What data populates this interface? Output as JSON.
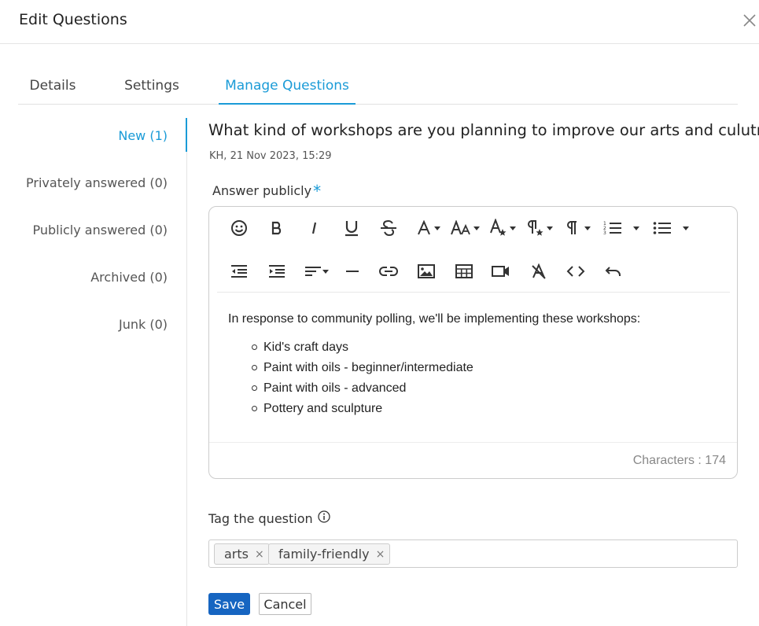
{
  "dialog": {
    "title": "Edit Questions"
  },
  "tabs": [
    {
      "label": "Details"
    },
    {
      "label": "Settings"
    },
    {
      "label": "Manage Questions"
    }
  ],
  "active_tab": "Manage Questions",
  "side_nav": [
    {
      "label": "New (1)"
    },
    {
      "label": "Privately answered (0)"
    },
    {
      "label": "Publicly answered (0)"
    },
    {
      "label": "Archived (0)"
    },
    {
      "label": "Junk (0)"
    }
  ],
  "active_side_item": "New (1)",
  "question": {
    "text": "What kind of workshops are you planning to improve our arts and culutre?",
    "meta": "KH, 21 Nov 2023, 15:29"
  },
  "answer": {
    "label": "Answer publicly",
    "required_marker": "*",
    "intro": "In response to community polling, we'll be implementing these workshops:",
    "items": [
      "Kid's craft days",
      "Paint with oils - beginner/intermediate",
      "Paint with oils - advanced",
      "Pottery and sculpture"
    ],
    "char_count": "Characters : 174"
  },
  "toolbar_icons": [
    "emoticon-icon",
    "bold-icon",
    "italic-icon",
    "underline-icon",
    "strikethrough-icon",
    "font-color-icon",
    "font-size-icon",
    "font-style-icon",
    "paragraph-style-icon",
    "paragraph-format-icon",
    "ordered-list-icon",
    "unordered-list-icon",
    "outdent-icon",
    "indent-icon",
    "align-icon",
    "horizontal-line-icon",
    "link-icon",
    "image-icon",
    "table-icon",
    "video-icon",
    "clear-formatting-icon",
    "code-view-icon",
    "undo-icon"
  ],
  "tags": {
    "label": "Tag the question",
    "items": [
      {
        "label": "arts"
      },
      {
        "label": "family-friendly"
      }
    ],
    "remove_symbol": "×"
  },
  "actions": {
    "save": "Save",
    "cancel": "Cancel"
  },
  "colors": {
    "accent": "#1a9bd7",
    "primary_button": "#1665c1",
    "text": "#333333",
    "border": "#cccccc"
  }
}
